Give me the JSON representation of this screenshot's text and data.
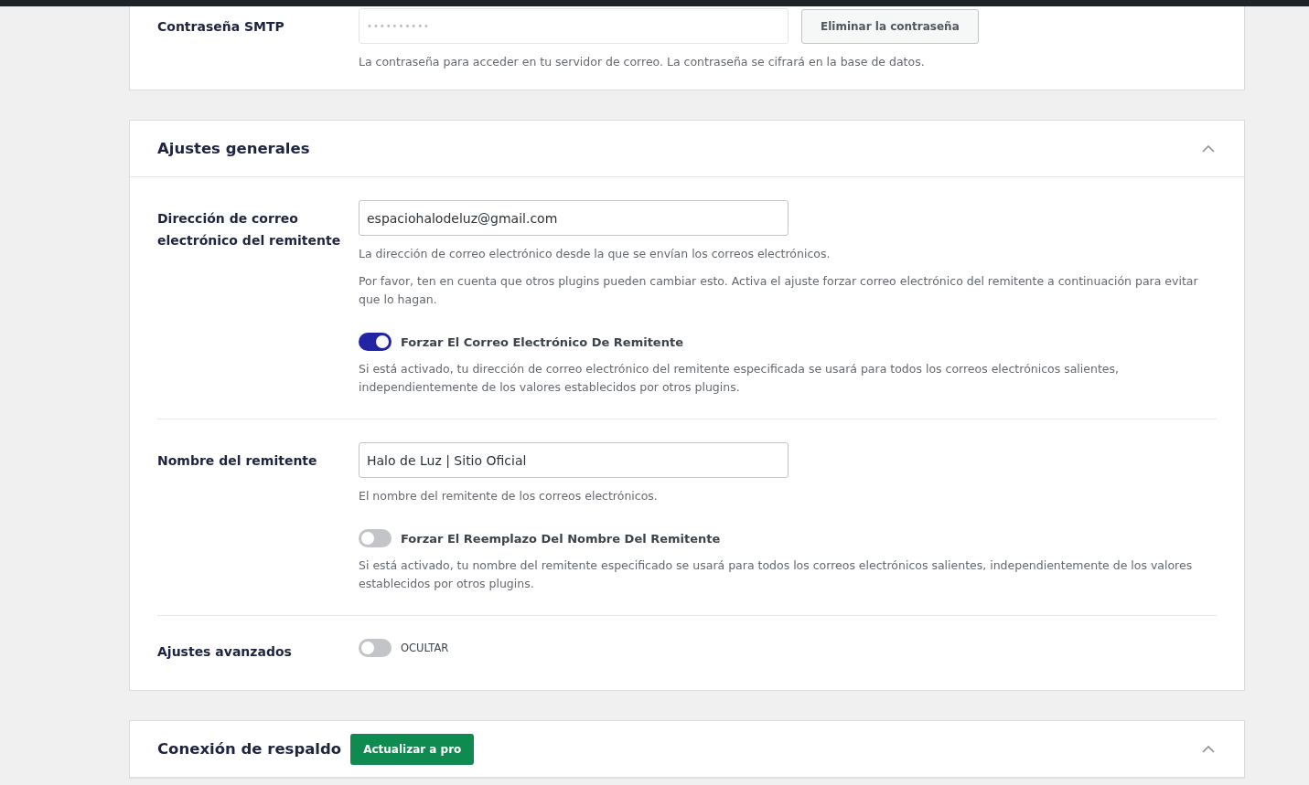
{
  "smtp_password": {
    "label": "Contraseña SMTP",
    "value": "••••••••••",
    "button": "Eliminar la contraseña",
    "help": "La contraseña para acceder en tu servidor de correo. La contraseña se cifrará en la base de datos."
  },
  "general_settings": {
    "title": "Ajustes generales",
    "expanded": true,
    "rows": [
      {
        "label": "Dirección de correo electrónico del remitente",
        "field": {
          "value": "espaciohalodeluz@gmail.com"
        },
        "help": [
          "La dirección de correo electrónico desde la que se envían los correos electrónicos.",
          "Por favor, ten en cuenta que otros plugins pueden cambiar esto. Activa el ajuste forzar correo electrónico del remitente a continuación para evitar que lo hagan."
        ],
        "toggle": {
          "label": "Forzar El Correo Electrónico De Remitente",
          "on": true,
          "help": "Si está activado, tu dirección de correo electrónico del remitente especificada se usará para todos los correos electrónicos salientes, independientemente de los valores establecidos por otros plugins."
        }
      },
      {
        "label": "Nombre del remitente",
        "field": {
          "value": "Halo de Luz | Sitio Oficial"
        },
        "help": [
          "El nombre del remitente de los correos electrónicos."
        ],
        "toggle": {
          "label": "Forzar El Reemplazo Del Nombre Del Remitente",
          "on": false,
          "help": "Si está activado, tu nombre del remitente especificado se usará para todos los correos electrónicos salientes, independientemente de los valores establecidos por otros plugins."
        }
      },
      {
        "label": "Ajustes avanzados",
        "toggle": {
          "label": "OCULTAR",
          "on": false,
          "kind": "compact"
        }
      }
    ]
  },
  "backup_connection": {
    "title": "Conexión de respaldo",
    "badge": "Actualizar a pro",
    "expanded": true
  }
}
